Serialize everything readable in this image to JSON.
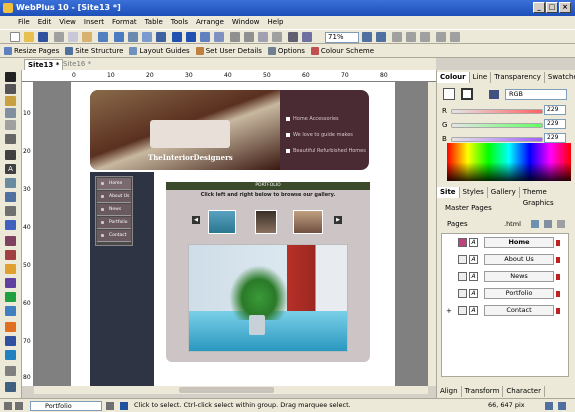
{
  "window": {
    "title": "WebPlus 10 - [Site13 *]"
  },
  "menu": [
    "File",
    "Edit",
    "View",
    "Insert",
    "Format",
    "Table",
    "Tools",
    "Arrange",
    "Window",
    "Help"
  ],
  "toolbar": {
    "zoom_value": "71%"
  },
  "context_toolbar": {
    "resize_pages": "Resize Pages",
    "site_structure": "Site Structure",
    "layout_guides": "Layout Guides",
    "set_user_details": "Set User Details",
    "options": "Options",
    "colour_scheme": "Colour Scheme"
  },
  "doc_tabs": [
    {
      "label": "Site13 *"
    },
    {
      "label": "Site16 *"
    }
  ],
  "ruler": {
    "h_ticks": [
      "0",
      "10",
      "20",
      "30",
      "40",
      "50",
      "60",
      "70",
      "80"
    ],
    "v_ticks": [
      "10",
      "20",
      "30",
      "40",
      "50",
      "60",
      "70",
      "80"
    ]
  },
  "webpage": {
    "logo": "TheInteriorDesigners",
    "header_items": [
      "Home Accessories",
      "We love to guide makes",
      "Beautiful Refurbished Homes"
    ],
    "nav": [
      "Home",
      "About Us",
      "News",
      "Portfolio",
      "Contact"
    ],
    "portfolio_bar": "PORTFOLIO",
    "caption": "Click left and right below to browse our gallery."
  },
  "colour_panel": {
    "tabs": [
      "Colour",
      "Line",
      "Transparency",
      "Swatches"
    ],
    "mode": "RGB",
    "channels": [
      {
        "label": "R",
        "value": "229"
      },
      {
        "label": "G",
        "value": "229"
      },
      {
        "label": "B",
        "value": "229"
      }
    ]
  },
  "site_panel": {
    "tabs": [
      "Site",
      "Styles",
      "Gallery",
      "Theme Graphics"
    ],
    "master_pages": "Master Pages",
    "pages_label": "Pages",
    "html_label": ".html",
    "pages": [
      "Home",
      "About Us",
      "News",
      "Portfolio",
      "Contact"
    ]
  },
  "bottom_tabs": [
    "Align",
    "Transform",
    "Character"
  ],
  "status": {
    "page_name": "Portfolio",
    "message": "Click to select. Ctrl-click select within group. Drag marquee select.",
    "coords": "66, 647 pix"
  },
  "colors": {
    "title_bar": "#1e4fb8",
    "header_bg": "#4a2b33",
    "nav_bg": "#2e3444"
  }
}
